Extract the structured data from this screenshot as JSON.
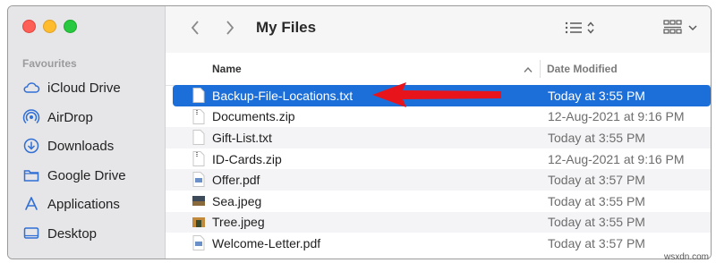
{
  "window": {
    "title": "My Files"
  },
  "sidebar": {
    "header": "Favourites",
    "items": [
      {
        "label": "iCloud Drive",
        "icon": "cloud-icon"
      },
      {
        "label": "AirDrop",
        "icon": "airdrop-icon"
      },
      {
        "label": "Downloads",
        "icon": "downloads-icon"
      },
      {
        "label": "Google Drive",
        "icon": "folder-icon"
      },
      {
        "label": "Applications",
        "icon": "applications-icon"
      },
      {
        "label": "Desktop",
        "icon": "desktop-icon"
      }
    ]
  },
  "columns": {
    "name": "Name",
    "date": "Date Modified"
  },
  "files": [
    {
      "name": "Backup-File-Locations.txt",
      "date": "Today at 3:55 PM",
      "icon": "text-file-icon",
      "selected": true
    },
    {
      "name": "Documents.zip",
      "date": "12-Aug-2021 at 9:16 PM",
      "icon": "zip-file-icon"
    },
    {
      "name": "Gift-List.txt",
      "date": "Today at 3:55 PM",
      "icon": "text-file-icon"
    },
    {
      "name": "ID-Cards.zip",
      "date": "12-Aug-2021 at 9:16 PM",
      "icon": "zip-file-icon"
    },
    {
      "name": "Offer.pdf",
      "date": "Today at 3:57 PM",
      "icon": "pdf-file-icon"
    },
    {
      "name": "Sea.jpeg",
      "date": "Today at 3:55 PM",
      "icon": "image-file-icon"
    },
    {
      "name": "Tree.jpeg",
      "date": "Today at 3:55 PM",
      "icon": "image-file-icon"
    },
    {
      "name": "Welcome-Letter.pdf",
      "date": "Today at 3:57 PM",
      "icon": "pdf-file-icon"
    }
  ],
  "watermark": "wsxdn.com",
  "colors": {
    "selection": "#1c6fd9",
    "arrow": "#e8141b",
    "sidebar_icon": "#2f6fd6"
  }
}
